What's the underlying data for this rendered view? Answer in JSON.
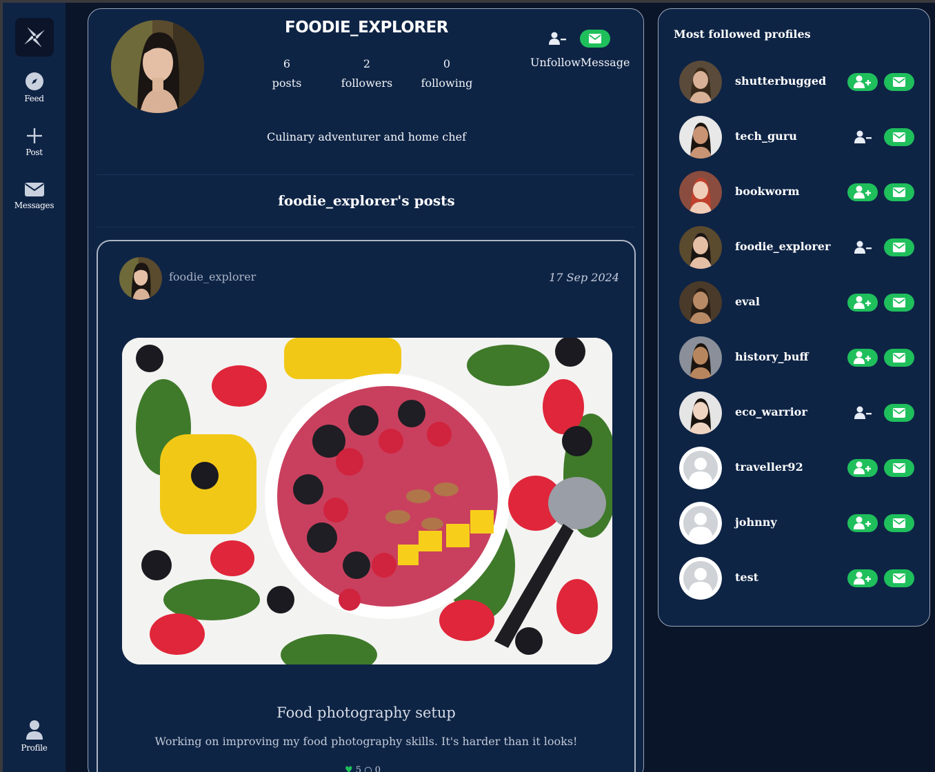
{
  "nav": {
    "items": [
      {
        "label": "Feed",
        "icon": "compass-icon"
      },
      {
        "label": "Post",
        "icon": "plus-icon"
      },
      {
        "label": "Messages",
        "icon": "envelope-icon"
      }
    ],
    "profile": {
      "label": "Profile",
      "icon": "user-icon"
    }
  },
  "profile": {
    "username": "FOODIE_EXPLORER",
    "stats": [
      {
        "value": "6",
        "label": "posts"
      },
      {
        "value": "2",
        "label": "followers"
      },
      {
        "value": "0",
        "label": "following"
      }
    ],
    "unfollow_label": "Unfollow",
    "message_label": "Message",
    "bio": "Culinary adventurer and home chef",
    "posts_heading": "foodie_explorer's posts"
  },
  "post": {
    "author": "foodie_explorer",
    "date": "17 Sep 2024",
    "title": "Food photography setup",
    "body": "Working on improving my food photography skills. It's harder than it looks!",
    "likes": "5",
    "comments": "0"
  },
  "right_panel": {
    "title": "Most followed profiles",
    "profiles": [
      {
        "name": "shutterbugged",
        "following": false
      },
      {
        "name": "tech_guru",
        "following": true
      },
      {
        "name": "bookworm",
        "following": false
      },
      {
        "name": "foodie_explorer",
        "following": true
      },
      {
        "name": "eval",
        "following": false
      },
      {
        "name": "history_buff",
        "following": false
      },
      {
        "name": "eco_warrior",
        "following": true
      },
      {
        "name": "traveller92",
        "following": false
      },
      {
        "name": "johnny",
        "following": false
      },
      {
        "name": "test",
        "following": false
      }
    ]
  },
  "colors": {
    "background": "#0b1529",
    "panel": "#0e2445",
    "accent": "#1fbf5c",
    "border": "#9aa5b8"
  }
}
